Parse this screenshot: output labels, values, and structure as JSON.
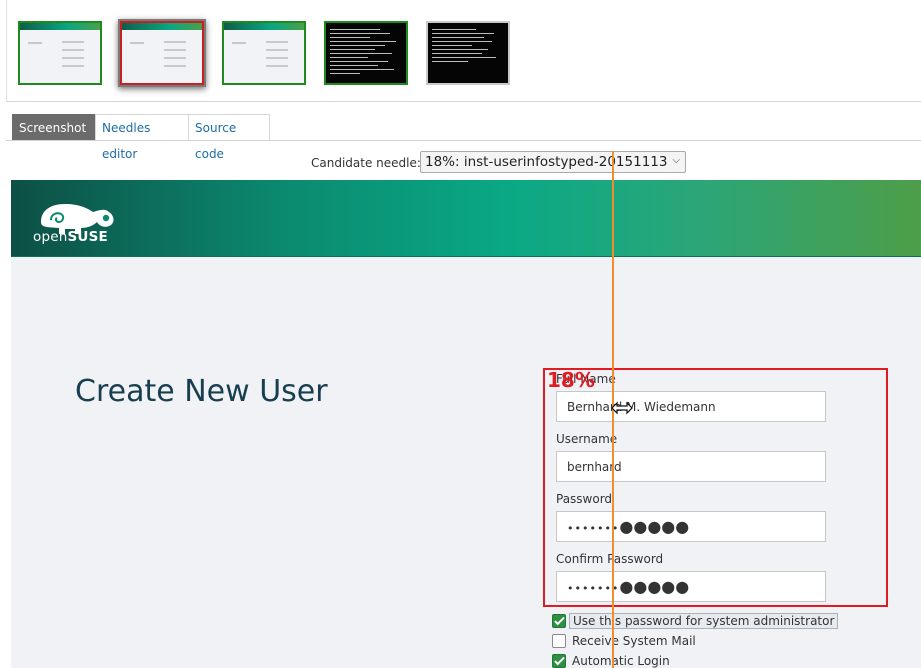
{
  "thumbnails": [
    {
      "status": "ok",
      "variant": "light"
    },
    {
      "status": "fail",
      "variant": "light"
    },
    {
      "status": "ok",
      "variant": "light"
    },
    {
      "status": "ok",
      "variant": "dark"
    },
    {
      "status": "none",
      "variant": "dark"
    }
  ],
  "tabs": [
    {
      "label": "Screenshot",
      "active": true
    },
    {
      "label": "Needles editor",
      "active": false
    },
    {
      "label": "Source code",
      "active": false
    }
  ],
  "needle": {
    "label": "Candidate needle:",
    "selected": "18%: inst-userinfostyped-20151113"
  },
  "screen": {
    "brand": {
      "prefix": "open",
      "suffix": "SUSE"
    },
    "title": "Create New User",
    "fields": {
      "full_name": {
        "label": "Full Name",
        "value": "Bernhard M. Wiedemann"
      },
      "username": {
        "label": "Username",
        "value": "bernhard"
      },
      "password": {
        "label": "Password",
        "small_dots": "•••••••",
        "big_dots": "●●●●●"
      },
      "confirm_password": {
        "label": "Confirm Password",
        "small_dots": "•••••••",
        "big_dots": "●●●●●"
      }
    },
    "checkboxes": [
      {
        "label": "Use this password for system administrator",
        "checked": true
      },
      {
        "label": "Receive System Mail",
        "checked": false
      },
      {
        "label": "Automatic Login",
        "checked": true
      }
    ]
  },
  "match": {
    "percent": "18%"
  },
  "colors": {
    "match_box": "#e11b22",
    "splitter": "#ef8d2f",
    "ok_border": "#1f8a1f",
    "fail_border": "#c82020"
  }
}
